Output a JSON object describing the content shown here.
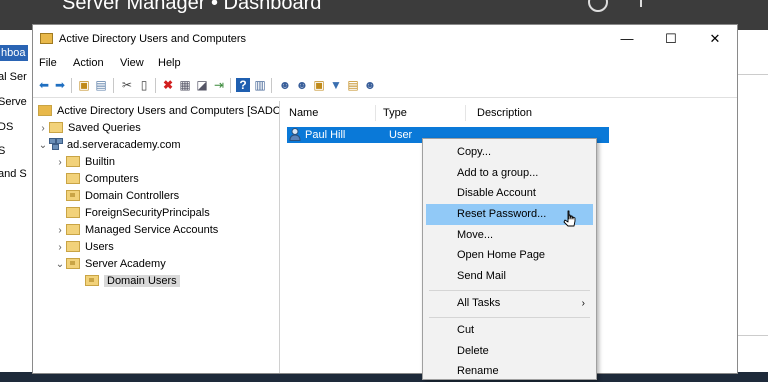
{
  "server_manager": {
    "title": "Server Manager • Dashboard",
    "nav": [
      "hboa",
      "al Ser",
      "Serve",
      "DS",
      "S",
      "and S"
    ]
  },
  "window": {
    "title": "Active Directory Users and Computers",
    "minimize": "—",
    "maximize": "☐",
    "close": "✕"
  },
  "menu": [
    "File",
    "Action",
    "View",
    "Help"
  ],
  "tree": {
    "root": "Active Directory Users and Computers [SADC",
    "saved_queries": "Saved Queries",
    "domain": "ad.serveracademy.com",
    "builtin": "Builtin",
    "computers": "Computers",
    "domain_controllers": "Domain Controllers",
    "fsp": "ForeignSecurityPrincipals",
    "msa": "Managed Service Accounts",
    "users": "Users",
    "server_academy": "Server Academy",
    "domain_users": "Domain Users"
  },
  "list": {
    "columns": [
      "Name",
      "Type",
      "Description"
    ],
    "rows": [
      {
        "name": "Paul Hill",
        "type": "User",
        "description": ""
      }
    ]
  },
  "context_menu": {
    "items": [
      "Copy...",
      "Add to a group...",
      "Disable Account",
      "Reset Password...",
      "Move...",
      "Open Home Page",
      "Send Mail"
    ],
    "all_tasks": "All Tasks",
    "edit_items": [
      "Cut",
      "Delete",
      "Rename"
    ],
    "highlighted": "Reset Password..."
  },
  "colors": {
    "selection": "#0a79d8",
    "menu_hover": "#91c9f7",
    "active_nav": "#2a64b4"
  }
}
